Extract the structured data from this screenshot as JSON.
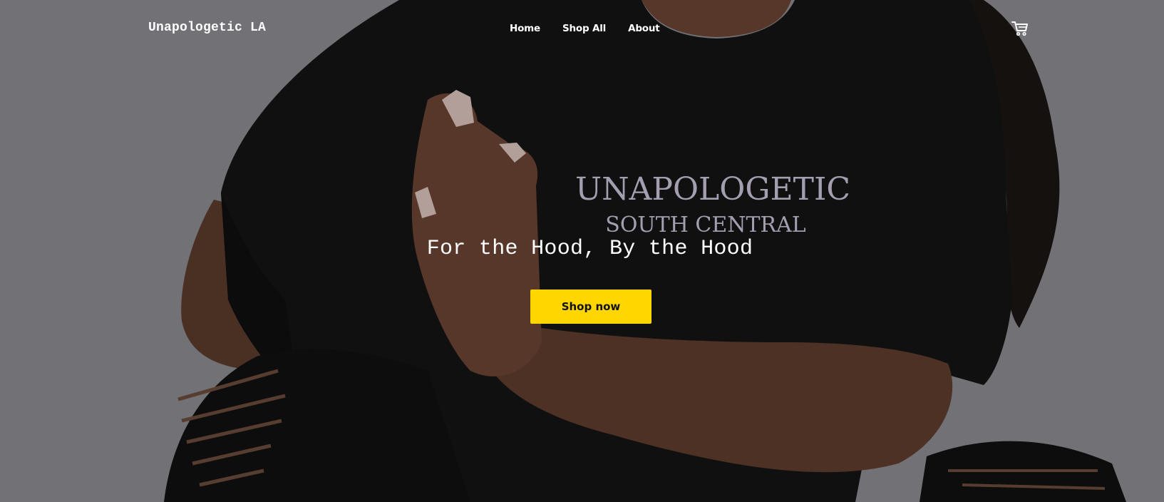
{
  "header": {
    "brand": "Unapologetic LA",
    "nav": [
      {
        "label": "Home"
      },
      {
        "label": "Shop All"
      },
      {
        "label": "About"
      }
    ],
    "cart_icon": "shopping-cart-icon"
  },
  "hero": {
    "title": "For the Hood, By the Hood",
    "cta_label": "Shop now",
    "cta_color": "#ffd600",
    "shirt_print_line1": "UNAPOLOGETIC",
    "shirt_print_line2": "SOUTH CENTRAL"
  }
}
